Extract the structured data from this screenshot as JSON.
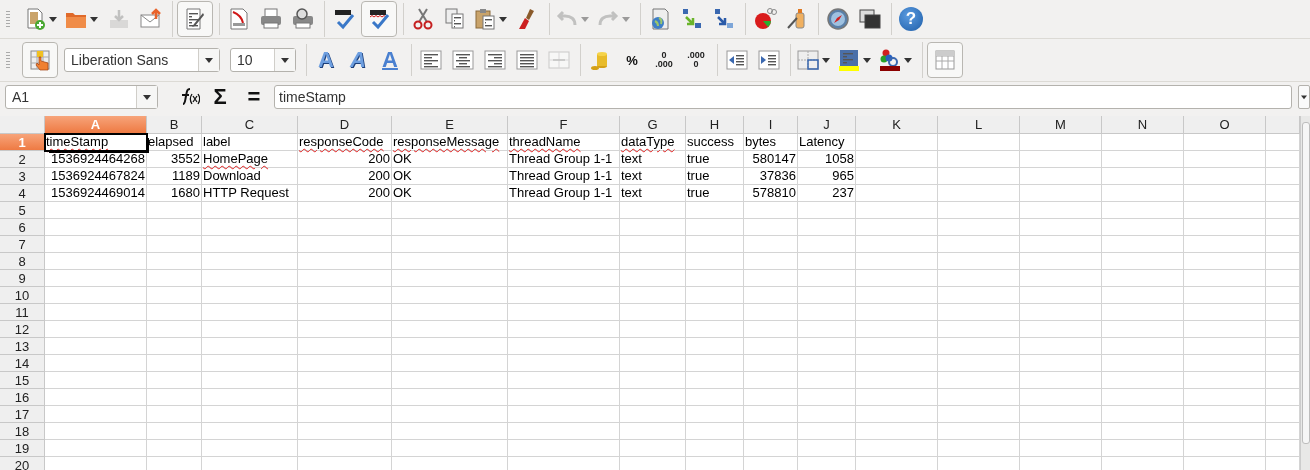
{
  "toolbars": [
    {
      "groups": [
        [
          {
            "kind": "new",
            "selected": false,
            "disabled": false,
            "menu": true
          },
          {
            "kind": "open",
            "selected": false,
            "disabled": false,
            "menu": true
          },
          {
            "kind": "save",
            "selected": false,
            "disabled": true,
            "menu": false
          },
          {
            "kind": "email",
            "selected": false,
            "disabled": false,
            "menu": false
          }
        ],
        [
          {
            "kind": "edit",
            "selected": true,
            "disabled": false,
            "menu": false
          }
        ],
        [
          {
            "kind": "pdf",
            "selected": false,
            "disabled": false,
            "menu": false
          },
          {
            "kind": "print",
            "selected": false,
            "disabled": false,
            "menu": false
          },
          {
            "kind": "preview",
            "selected": false,
            "disabled": false,
            "menu": false
          }
        ],
        [
          {
            "kind": "spell",
            "selected": false,
            "disabled": false,
            "menu": false
          },
          {
            "kind": "autospell",
            "selected": true,
            "disabled": false,
            "menu": false
          }
        ],
        [
          {
            "kind": "cut",
            "selected": false,
            "disabled": false,
            "menu": false
          },
          {
            "kind": "copy",
            "selected": false,
            "disabled": false,
            "menu": false
          },
          {
            "kind": "paste",
            "selected": false,
            "disabled": false,
            "menu": true
          },
          {
            "kind": "brush",
            "selected": false,
            "disabled": false,
            "menu": false
          }
        ],
        [
          {
            "kind": "undo",
            "selected": false,
            "disabled": true,
            "menu": true
          },
          {
            "kind": "redo",
            "selected": false,
            "disabled": true,
            "menu": true
          }
        ],
        [
          {
            "kind": "hyperlink",
            "selected": false,
            "disabled": false,
            "menu": false
          },
          {
            "kind": "sortasc",
            "selected": false,
            "disabled": false,
            "menu": false
          },
          {
            "kind": "sortdesc",
            "selected": false,
            "disabled": false,
            "menu": false
          }
        ],
        [
          {
            "kind": "chart",
            "selected": false,
            "disabled": false,
            "menu": false
          },
          {
            "kind": "draw",
            "selected": false,
            "disabled": false,
            "menu": false
          }
        ],
        [
          {
            "kind": "navigator",
            "selected": false,
            "disabled": false,
            "menu": false
          },
          {
            "kind": "windows",
            "selected": false,
            "disabled": false,
            "menu": false
          }
        ],
        [
          {
            "kind": "help",
            "label": "?",
            "selected": false,
            "disabled": false,
            "menu": false
          }
        ]
      ]
    },
    {
      "groups": [
        [
          {
            "kind": "styles",
            "selected": true,
            "disabled": false,
            "menu": false
          },
          {
            "kind": "fontname",
            "value": "Liberation Sans"
          },
          {
            "kind": "fontsize",
            "value": "10"
          }
        ],
        [
          {
            "kind": "bold",
            "label": "A",
            "selected": false,
            "disabled": false,
            "menu": false
          },
          {
            "kind": "italic",
            "label": "A",
            "selected": false,
            "disabled": false,
            "menu": false
          },
          {
            "kind": "underline",
            "label": "A",
            "selected": false,
            "disabled": false,
            "menu": false
          }
        ],
        [
          {
            "kind": "alignleft",
            "selected": false,
            "disabled": false,
            "menu": false
          },
          {
            "kind": "aligncenter",
            "selected": false,
            "disabled": false,
            "menu": false
          },
          {
            "kind": "alignright",
            "selected": false,
            "disabled": false,
            "menu": false
          },
          {
            "kind": "justify",
            "selected": false,
            "disabled": false,
            "menu": false
          },
          {
            "kind": "merge",
            "selected": false,
            "disabled": true,
            "menu": false
          }
        ],
        [
          {
            "kind": "currency",
            "selected": false,
            "disabled": false,
            "menu": false
          },
          {
            "kind": "percent",
            "label": "%",
            "selected": false,
            "disabled": false,
            "menu": false
          },
          {
            "kind": "adddecimal",
            "lines": [
              "0",
              ".000"
            ],
            "selected": false,
            "disabled": false,
            "menu": false
          },
          {
            "kind": "deldecimal",
            "lines": [
              ".000",
              "0"
            ],
            "selected": false,
            "disabled": false,
            "menu": false
          }
        ],
        [
          {
            "kind": "outdent",
            "selected": false,
            "disabled": false,
            "menu": false
          },
          {
            "kind": "indent",
            "selected": false,
            "disabled": false,
            "menu": false
          }
        ],
        [
          {
            "kind": "borders",
            "selected": false,
            "disabled": false,
            "menu": true
          },
          {
            "kind": "background",
            "color": "#ffff00",
            "selected": false,
            "disabled": false,
            "menu": true
          },
          {
            "kind": "fontcolor",
            "color": "#8b0000",
            "selected": false,
            "disabled": false,
            "menu": true
          }
        ],
        [
          {
            "kind": "grid",
            "selected": true,
            "disabled": false,
            "menu": false
          }
        ]
      ]
    }
  ],
  "formula_bar": {
    "cell_ref": "A1",
    "sum": "Σ",
    "equals": "=",
    "content": "timeStamp"
  },
  "columns": [
    {
      "label": "A",
      "selected": true
    },
    {
      "label": "B",
      "selected": false
    },
    {
      "label": "C",
      "selected": false
    },
    {
      "label": "D",
      "selected": false
    },
    {
      "label": "E",
      "selected": false
    },
    {
      "label": "F",
      "selected": false
    },
    {
      "label": "G",
      "selected": false
    },
    {
      "label": "H",
      "selected": false
    },
    {
      "label": "I",
      "selected": false
    },
    {
      "label": "J",
      "selected": false
    },
    {
      "label": "K",
      "selected": false
    },
    {
      "label": "L",
      "selected": false
    },
    {
      "label": "M",
      "selected": false
    },
    {
      "label": "N",
      "selected": false
    },
    {
      "label": "O",
      "selected": false
    }
  ],
  "rows": [
    {
      "label": "1",
      "selected": true,
      "cells": [
        {
          "text": "timeStamp",
          "kind": "text",
          "misspelled": true
        },
        {
          "text": "elapsed",
          "kind": "text",
          "misspelled": false
        },
        {
          "text": "label",
          "kind": "text",
          "misspelled": false
        },
        {
          "text": "responseCode",
          "kind": "text",
          "misspelled": true
        },
        {
          "text": "responseMessage",
          "kind": "text",
          "misspelled": true
        },
        {
          "text": "threadName",
          "kind": "text",
          "misspelled": true
        },
        {
          "text": "dataType",
          "kind": "text",
          "misspelled": true
        },
        {
          "text": "success",
          "kind": "text",
          "misspelled": false
        },
        {
          "text": "bytes",
          "kind": "text",
          "misspelled": false
        },
        {
          "text": "Latency",
          "kind": "text",
          "misspelled": false
        }
      ]
    },
    {
      "label": "2",
      "selected": false,
      "cells": [
        {
          "text": "1536924464268",
          "kind": "number",
          "misspelled": false
        },
        {
          "text": "3552",
          "kind": "number",
          "misspelled": false
        },
        {
          "text": "HomePage",
          "kind": "text",
          "misspelled": true
        },
        {
          "text": "200",
          "kind": "number",
          "misspelled": false
        },
        {
          "text": "OK",
          "kind": "text",
          "misspelled": false
        },
        {
          "text": "Thread Group 1-1",
          "kind": "text",
          "misspelled": false
        },
        {
          "text": "text",
          "kind": "text",
          "misspelled": false
        },
        {
          "text": "true",
          "kind": "text",
          "misspelled": false
        },
        {
          "text": "580147",
          "kind": "number",
          "misspelled": false
        },
        {
          "text": "1058",
          "kind": "number",
          "misspelled": false
        }
      ]
    },
    {
      "label": "3",
      "selected": false,
      "cells": [
        {
          "text": "1536924467824",
          "kind": "number",
          "misspelled": false
        },
        {
          "text": "1189",
          "kind": "number",
          "misspelled": false
        },
        {
          "text": "Download",
          "kind": "text",
          "misspelled": false
        },
        {
          "text": "200",
          "kind": "number",
          "misspelled": false
        },
        {
          "text": "OK",
          "kind": "text",
          "misspelled": false
        },
        {
          "text": "Thread Group 1-1",
          "kind": "text",
          "misspelled": false
        },
        {
          "text": "text",
          "kind": "text",
          "misspelled": false
        },
        {
          "text": "true",
          "kind": "text",
          "misspelled": false
        },
        {
          "text": "37836",
          "kind": "number",
          "misspelled": false
        },
        {
          "text": "965",
          "kind": "number",
          "misspelled": false
        }
      ]
    },
    {
      "label": "4",
      "selected": false,
      "cells": [
        {
          "text": "1536924469014",
          "kind": "number",
          "misspelled": false
        },
        {
          "text": "1680",
          "kind": "number",
          "misspelled": false
        },
        {
          "text": "HTTP Request",
          "kind": "text",
          "misspelled": false
        },
        {
          "text": "200",
          "kind": "number",
          "misspelled": false
        },
        {
          "text": "OK",
          "kind": "text",
          "misspelled": false
        },
        {
          "text": "Thread Group 1-1",
          "kind": "text",
          "misspelled": false
        },
        {
          "text": "text",
          "kind": "text",
          "misspelled": false
        },
        {
          "text": "true",
          "kind": "text",
          "misspelled": false
        },
        {
          "text": "578810",
          "kind": "number",
          "misspelled": false
        },
        {
          "text": "237",
          "kind": "number",
          "misspelled": false
        }
      ]
    },
    {
      "label": "5",
      "selected": false
    },
    {
      "label": "6",
      "selected": false
    },
    {
      "label": "7",
      "selected": false
    },
    {
      "label": "8",
      "selected": false
    },
    {
      "label": "9",
      "selected": false
    },
    {
      "label": "10",
      "selected": false
    },
    {
      "label": "11",
      "selected": false
    },
    {
      "label": "12",
      "selected": false
    },
    {
      "label": "13",
      "selected": false
    },
    {
      "label": "14",
      "selected": false
    },
    {
      "label": "15",
      "selected": false
    },
    {
      "label": "16",
      "selected": false
    },
    {
      "label": "17",
      "selected": false
    },
    {
      "label": "18",
      "selected": false
    },
    {
      "label": "19",
      "selected": false
    },
    {
      "label": "20",
      "selected": false
    }
  ]
}
